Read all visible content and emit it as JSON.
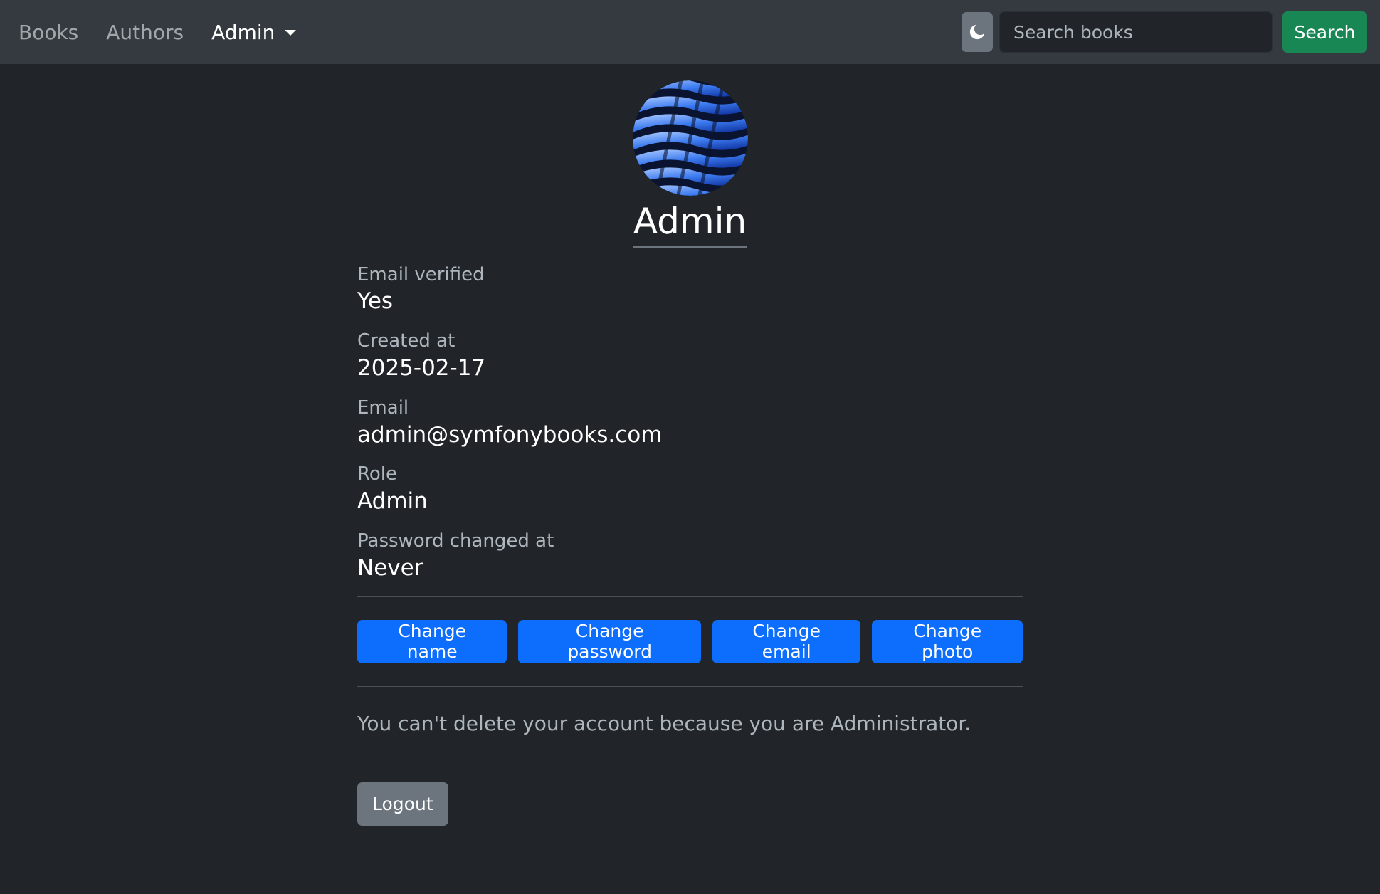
{
  "nav": {
    "links": [
      {
        "label": "Books"
      },
      {
        "label": "Authors"
      }
    ],
    "admin_dropdown_label": "Admin",
    "search": {
      "placeholder": "Search books",
      "value": ""
    },
    "search_button_label": "Search",
    "theme_toggle_icon": "moon-icon"
  },
  "profile": {
    "name": "Admin",
    "avatar_icon": "avatar-image",
    "fields": [
      {
        "label": "Email verified",
        "value": "Yes"
      },
      {
        "label": "Created at",
        "value": "2025-02-17"
      },
      {
        "label": "Email",
        "value": "admin@symfonybooks.com"
      },
      {
        "label": "Role",
        "value": "Admin"
      },
      {
        "label": "Password changed at",
        "value": "Never"
      }
    ],
    "actions": {
      "change_name": "Change name",
      "change_password": "Change password",
      "change_email": "Change email",
      "change_photo": "Change photo"
    },
    "delete_notice": "You can't delete your account because you are Administrator.",
    "logout_label": "Logout"
  },
  "colors": {
    "background": "#212529",
    "navbar": "#343a40",
    "primary": "#0d6efd",
    "success": "#198754",
    "secondary": "#6c757d"
  }
}
